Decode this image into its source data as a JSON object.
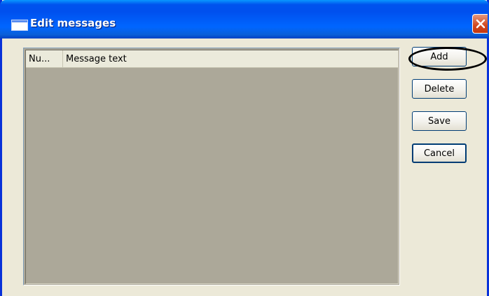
{
  "window": {
    "title": "Edit messages",
    "title_icon": "window-icon",
    "close_icon": "close-icon"
  },
  "list": {
    "columns": [
      {
        "label": "Nu..."
      },
      {
        "label": "Message text"
      }
    ],
    "rows": []
  },
  "buttons": {
    "add": "Add",
    "delete": "Delete",
    "save": "Save",
    "cancel": "Cancel"
  },
  "annotation": {
    "highlighted": "add-button"
  },
  "colors": {
    "titlebar": "#0055ea",
    "dialog_background": "#ece9d8",
    "list_background": "#aca899",
    "close_button": "#d1471f",
    "button_border": "#003c74"
  }
}
